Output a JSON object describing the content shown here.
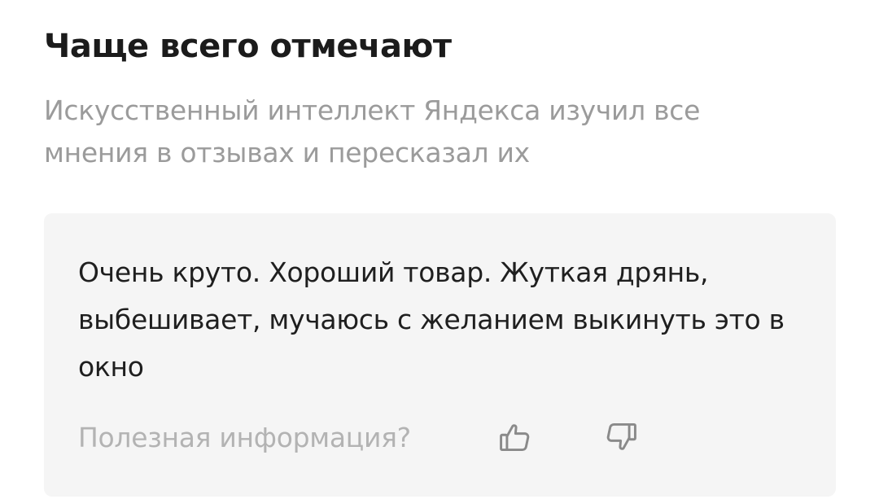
{
  "header": {
    "title": "Чаще всего отмечают",
    "subtitle": "Искусственный интеллект Яндекса изучил все мнения в отзывах и пересказал их"
  },
  "summary_card": {
    "text": "Очень круто. Хороший товар. Жуткая дрянь, выбешивает, мучаюсь с желанием выкинуть это в окно",
    "feedback_question": "Полезная информация?",
    "like_icon": "thumbs-up-icon",
    "dislike_icon": "thumbs-down-icon"
  },
  "colors": {
    "heading": "#1b1b1b",
    "subtitle": "#9b9b9b",
    "card_background": "#f5f5f5",
    "body_text": "#1f1f1f",
    "muted_text": "#b3b3b3",
    "icon": "#8a8a8a"
  }
}
